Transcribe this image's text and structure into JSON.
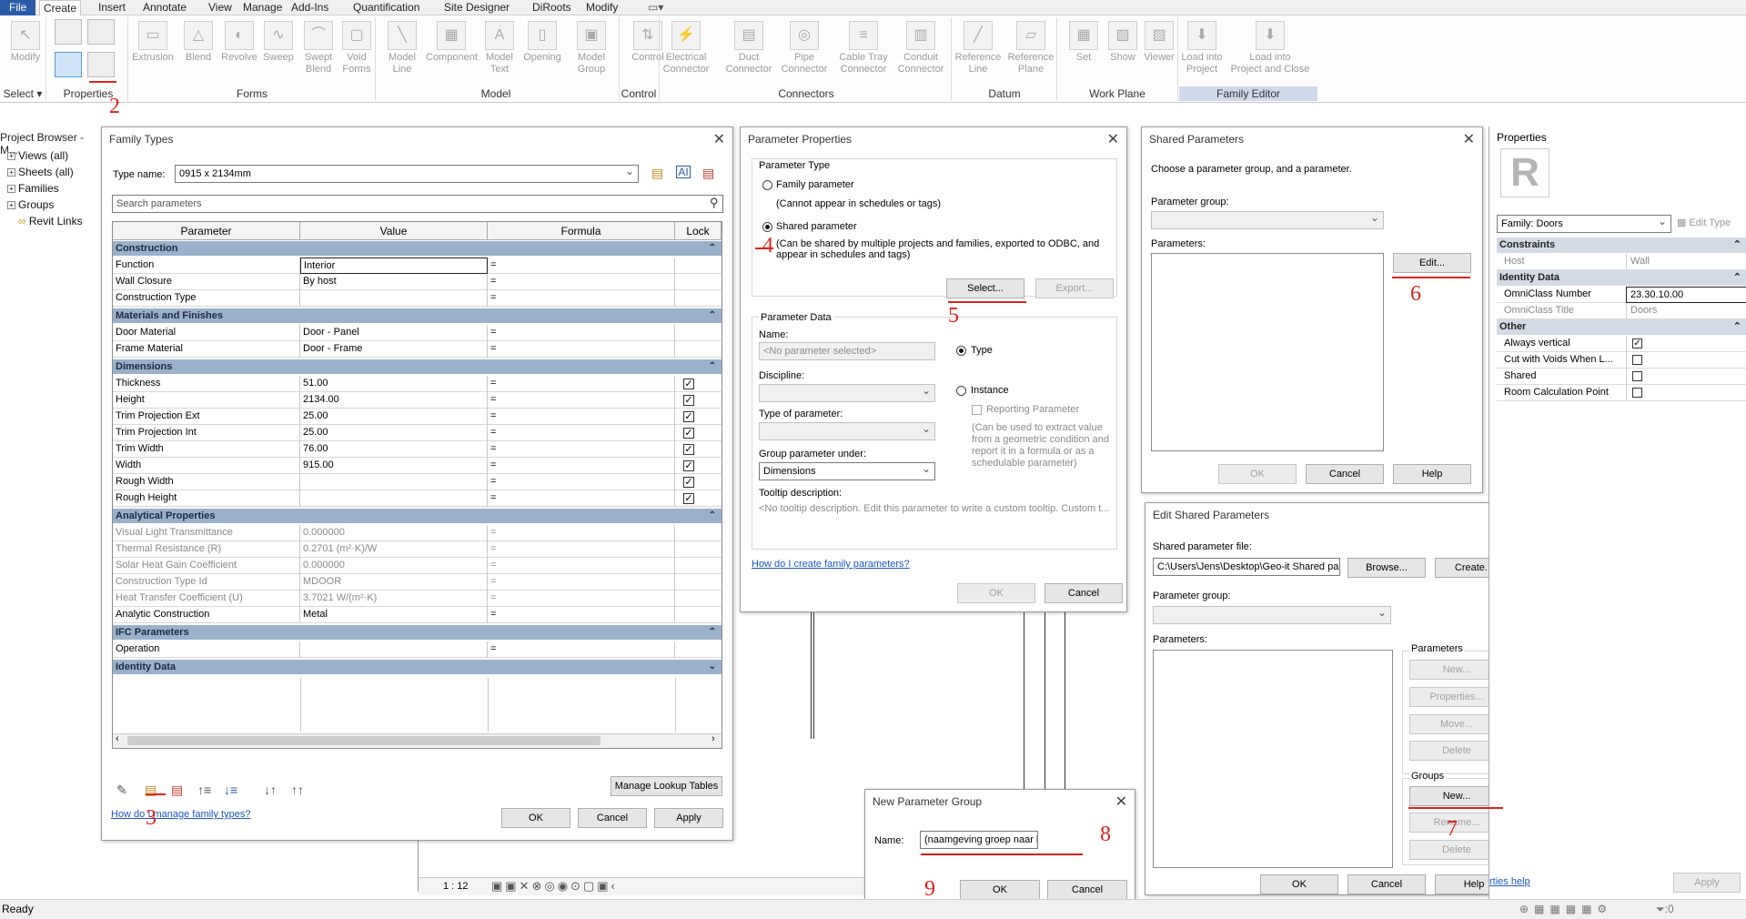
{
  "menu": {
    "tabs": [
      "File",
      "Create",
      "Insert",
      "Annotate",
      "View",
      "Manage",
      "Add-Ins",
      "Quantification",
      "Site Designer",
      "DiRoots",
      "Modify"
    ],
    "active": "Create"
  },
  "ribbon": {
    "buttons": [
      {
        "name": "modify-button",
        "label": "Modify",
        "glyph": "↖"
      },
      {
        "name": "extrusion-button",
        "label": "Extrusion",
        "glyph": "▭"
      },
      {
        "name": "blend-button",
        "label": "Blend",
        "glyph": "△"
      },
      {
        "name": "revolve-button",
        "label": "Revolve",
        "glyph": "◐"
      },
      {
        "name": "sweep-button",
        "label": "Sweep",
        "glyph": "∿"
      },
      {
        "name": "swept-blend-button",
        "label": "Swept\nBlend",
        "glyph": "⌒"
      },
      {
        "name": "void-forms-button",
        "label": "Void\nForms",
        "glyph": "▢"
      },
      {
        "name": "model-line-button",
        "label": "Model\nLine",
        "glyph": "╲"
      },
      {
        "name": "component-button",
        "label": "Component",
        "glyph": "▦"
      },
      {
        "name": "model-text-button",
        "label": "Model\nText",
        "glyph": "A"
      },
      {
        "name": "opening-button",
        "label": "Opening",
        "glyph": "▯"
      },
      {
        "name": "model-group-button",
        "label": "Model\nGroup",
        "glyph": "▣"
      },
      {
        "name": "control-button",
        "label": "Control",
        "glyph": "⇅"
      },
      {
        "name": "electrical-connector-button",
        "label": "Electrical\nConnector",
        "glyph": "⚡"
      },
      {
        "name": "duct-connector-button",
        "label": "Duct\nConnector",
        "glyph": "▤"
      },
      {
        "name": "pipe-connector-button",
        "label": "Pipe\nConnector",
        "glyph": "◎"
      },
      {
        "name": "cable-tray-connector-button",
        "label": "Cable Tray\nConnector",
        "glyph": "≡"
      },
      {
        "name": "conduit-connector-button",
        "label": "Conduit\nConnector",
        "glyph": "▥"
      },
      {
        "name": "reference-line-button",
        "label": "Reference\nLine",
        "glyph": "╱"
      },
      {
        "name": "reference-plane-button",
        "label": "Reference\nPlane",
        "glyph": "▱"
      },
      {
        "name": "set-button",
        "label": "Set",
        "glyph": "▦"
      },
      {
        "name": "show-button",
        "label": "Show",
        "glyph": "▧"
      },
      {
        "name": "viewer-button",
        "label": "Viewer",
        "glyph": "▨"
      },
      {
        "name": "load-into-project-button",
        "label": "Load into\nProject",
        "glyph": "⬇"
      },
      {
        "name": "load-into-project-and-close-button",
        "label": "Load into\nProject and Close",
        "glyph": "⬇"
      }
    ],
    "panels": [
      "Select",
      "Properties",
      "Forms",
      "Model",
      "Control",
      "Connectors",
      "Datum",
      "Work Plane",
      "Family Editor"
    ]
  },
  "annotations": [
    "2",
    "3",
    "4",
    "5",
    "6",
    "7",
    "8",
    "9"
  ],
  "project_browser": {
    "title": "Project Browser - M...",
    "items": [
      "Views (all)",
      "Sheets (all)",
      "Families",
      "Groups",
      "Revit Links"
    ]
  },
  "family_types": {
    "title": "Family Types",
    "type_name_label": "Type name:",
    "type_name_value": "0915 x 2134mm",
    "search_placeholder": "Search parameters",
    "columns": [
      "Parameter",
      "Value",
      "Formula",
      "Lock"
    ],
    "sections": [
      {
        "title": "Construction",
        "rows": [
          {
            "p": "Function",
            "v": "Interior",
            "f": "=",
            "lock": ""
          },
          {
            "p": "Wall Closure",
            "v": "By host",
            "f": "=",
            "lock": ""
          },
          {
            "p": "Construction Type",
            "v": "",
            "f": "=",
            "lock": ""
          }
        ]
      },
      {
        "title": "Materials and Finishes",
        "rows": [
          {
            "p": "Door Material",
            "v": "Door - Panel",
            "f": "=",
            "lock": ""
          },
          {
            "p": "Frame Material",
            "v": "Door - Frame",
            "f": "=",
            "lock": ""
          }
        ]
      },
      {
        "title": "Dimensions",
        "rows": [
          {
            "p": "Thickness",
            "v": "51.00",
            "f": "=",
            "lock": "✓"
          },
          {
            "p": "Height",
            "v": "2134.00",
            "f": "=",
            "lock": "✓"
          },
          {
            "p": "Trim Projection Ext",
            "v": "25.00",
            "f": "=",
            "lock": "✓"
          },
          {
            "p": "Trim Projection Int",
            "v": "25.00",
            "f": "=",
            "lock": "✓"
          },
          {
            "p": "Trim Width",
            "v": "76.00",
            "f": "=",
            "lock": "✓"
          },
          {
            "p": "Width",
            "v": "915.00",
            "f": "=",
            "lock": "✓"
          },
          {
            "p": "Rough Width",
            "v": "",
            "f": "=",
            "lock": "✓"
          },
          {
            "p": "Rough Height",
            "v": "",
            "f": "=",
            "lock": "✓"
          }
        ]
      },
      {
        "title": "Analytical Properties",
        "rows": [
          {
            "p": "Visual Light Transmittance",
            "v": "0.000000",
            "f": "=",
            "lock": "",
            "g": true
          },
          {
            "p": "Thermal Resistance (R)",
            "v": "0.2701 (m²·K)/W",
            "f": "=",
            "lock": "",
            "g": true
          },
          {
            "p": "Solar Heat Gain Coefficient",
            "v": "0.000000",
            "f": "=",
            "lock": "",
            "g": true
          },
          {
            "p": "Construction Type Id",
            "v": "MDOOR",
            "f": "=",
            "lock": "",
            "g": true
          },
          {
            "p": "Heat Transfer Coefficient (U)",
            "v": "3.7021 W/(m²·K)",
            "f": "=",
            "lock": "",
            "g": true
          },
          {
            "p": "Analytic Construction",
            "v": "Metal",
            "f": "=",
            "lock": ""
          }
        ]
      },
      {
        "title": "IFC Parameters",
        "rows": [
          {
            "p": "Operation",
            "v": "",
            "f": "=",
            "lock": ""
          }
        ]
      },
      {
        "title": "Identity Data",
        "rows": []
      }
    ],
    "manage_lookup_label": "Manage Lookup Tables",
    "help_link": "How do I manage family types?",
    "ok": "OK",
    "cancel": "Cancel",
    "apply": "Apply"
  },
  "parameter_properties": {
    "title": "Parameter Properties",
    "parameter_type": "Parameter Type",
    "family_parameter": "Family parameter",
    "family_note": "(Cannot appear in schedules or tags)",
    "shared_parameter": "Shared parameter",
    "shared_note": "(Can be shared by multiple projects and families, exported to ODBC, and appear in schedules and tags)",
    "select": "Select...",
    "export": "Export...",
    "parameter_data": "Parameter Data",
    "name_label": "Name:",
    "name_placeholder": "<No parameter selected>",
    "type_option": "Type",
    "instance_option": "Instance",
    "discipline_label": "Discipline:",
    "type_of_param_label": "Type of parameter:",
    "reporting": "Reporting Parameter",
    "reporting_note": "(Can be used to extract value from a geometric condition and report it in a formula or as a schedulable parameter)",
    "group_under_label": "Group parameter under:",
    "group_under_value": "Dimensions",
    "tooltip_label": "Tooltip description:",
    "tooltip_value": "<No tooltip description. Edit this parameter to write a custom tooltip. Custom t...",
    "help_link": "How do I create family parameters?",
    "ok": "OK",
    "cancel": "Cancel"
  },
  "shared_parameters": {
    "title": "Shared Parameters",
    "prompt": "Choose a parameter group, and a parameter.",
    "group_label": "Parameter group:",
    "params_label": "Parameters:",
    "edit": "Edit...",
    "ok": "OK",
    "cancel": "Cancel",
    "help": "Help"
  },
  "edit_shared_parameters": {
    "title": "Edit Shared Parameters",
    "file_label": "Shared parameter file:",
    "file_value": "C:\\Users\\Jens\\Desktop\\Geo-it Shared par",
    "browse": "Browse...",
    "create": "Create...",
    "group_label": "Parameter group:",
    "params_label": "Parameters:",
    "parameters_group": "Parameters",
    "p_new": "New...",
    "p_properties": "Properties...",
    "p_move": "Move...",
    "p_delete": "Delete",
    "groups_group": "Groups",
    "g_new": "New...",
    "g_rename": "Rename...",
    "g_delete": "Delete",
    "ok": "OK",
    "cancel": "Cancel",
    "help": "Help"
  },
  "new_parameter_group": {
    "title": "New Parameter Group",
    "name_label": "Name:",
    "name_value": "(naamgeving groep naar keuze)",
    "ok": "OK",
    "cancel": "Cancel"
  },
  "properties": {
    "title": "Properties",
    "family": "Family: Doors",
    "edit_type": "Edit Type",
    "sections": [
      {
        "title": "Constraints",
        "rows": [
          {
            "k": "Host",
            "v": "Wall",
            "g": true
          }
        ]
      },
      {
        "title": "Identity Data",
        "rows": [
          {
            "k": "OmniClass Number",
            "v": "23.30.10.00"
          },
          {
            "k": "OmniClass Title",
            "v": "Doors",
            "g": true
          }
        ]
      },
      {
        "title": "Other",
        "rows": [
          {
            "k": "Always vertical",
            "v": "✓",
            "cb": true
          },
          {
            "k": "Cut with Voids When L...",
            "v": "",
            "cb": true
          },
          {
            "k": "Shared",
            "v": "",
            "cb": true
          },
          {
            "k": "Room Calculation Point",
            "v": "",
            "cb": true
          }
        ]
      }
    ],
    "help_link": "rties help",
    "apply": "Apply"
  },
  "view": {
    "scale": "1 : 12"
  },
  "status": {
    "text": "Ready",
    "filter_count": ":0"
  }
}
